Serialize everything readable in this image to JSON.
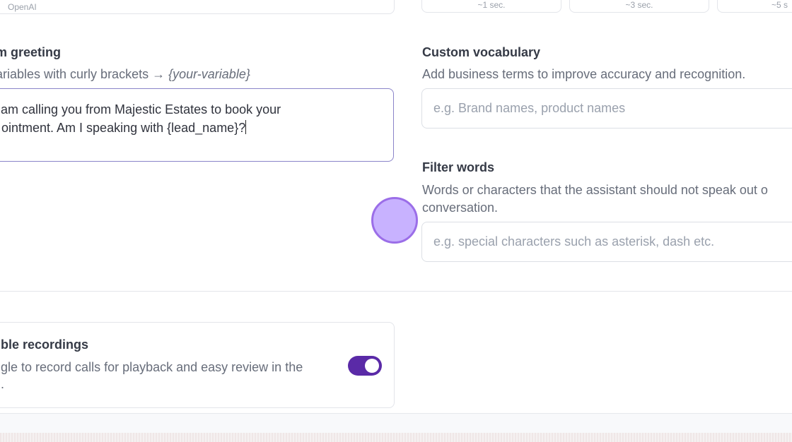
{
  "top": {
    "provider_label": "OpenAI",
    "latency_options": [
      {
        "label": "~1 sec."
      },
      {
        "label": "~3 sec."
      },
      {
        "label": "~5 s"
      }
    ]
  },
  "greeting": {
    "label": "m greeting",
    "help_prefix": "ariables with curly brackets → ",
    "help_example": "{your-variable}",
    "text_line1": "am calling you from Majestic Estates to book your",
    "text_line2": "ointment. Am I speaking with {lead_name}?"
  },
  "vocabulary": {
    "label": "Custom vocabulary",
    "help": "Add business terms to improve accuracy and recognition.",
    "placeholder": "e.g. Brand names, product names"
  },
  "filter_words": {
    "label": "Filter words",
    "help_line1": "Words or characters that the assistant should not speak out o",
    "help_line2": "conversation.",
    "placeholder": "e.g. special characters such as asterisk, dash etc."
  },
  "recordings": {
    "label": "ble recordings",
    "help_line1": "gle to record calls for playback and easy review in the",
    "help_line2": ".",
    "enabled": true
  },
  "colors": {
    "accent": "#5a2aa7",
    "touch": "#c8b2ff"
  }
}
